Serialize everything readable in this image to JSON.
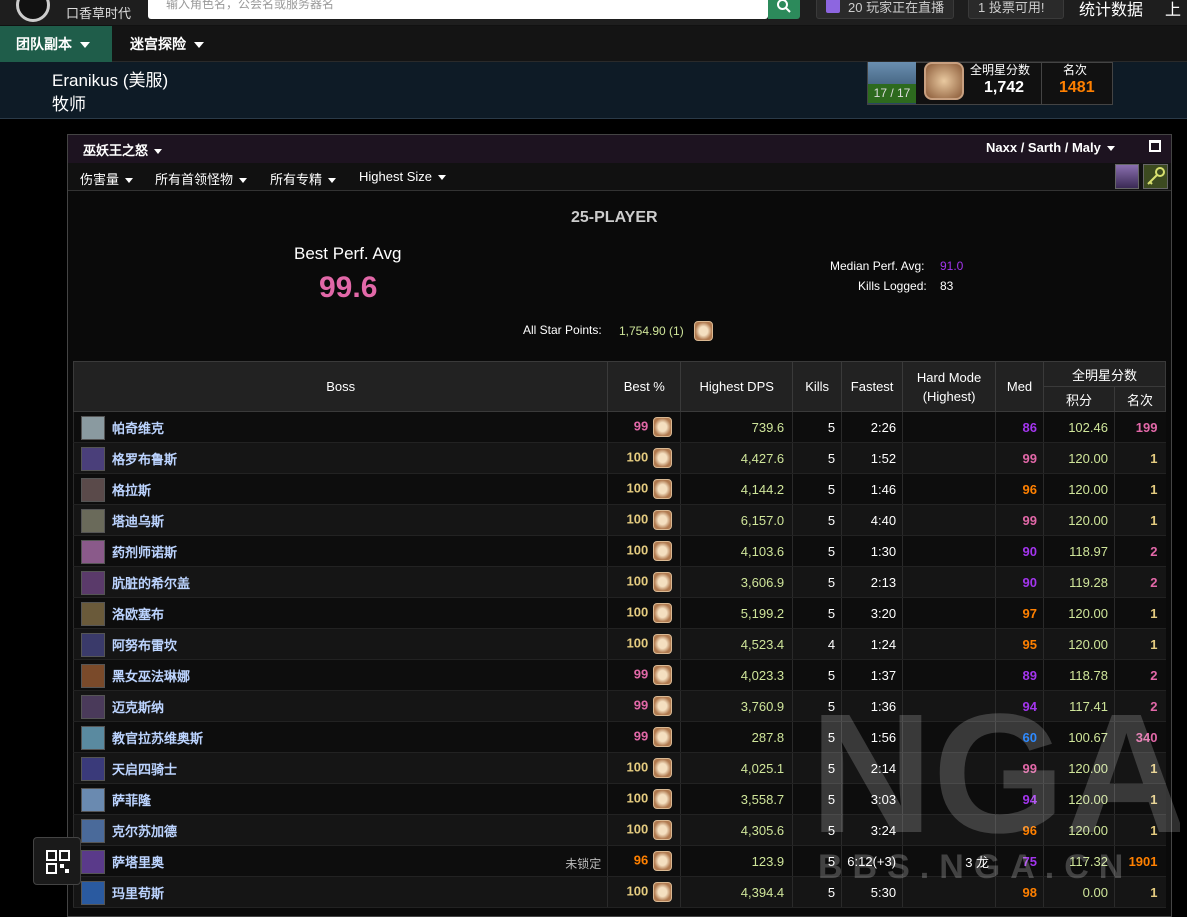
{
  "topbar": {
    "logo_text": "口香草时代",
    "search_placeholder": "输入角色名，公会名或服务器名",
    "live_text": "20 玩家正在直播",
    "vote_text": "1 投票可用!",
    "stats_link": "统计数据",
    "prev_link": "上一"
  },
  "nav": {
    "items": [
      {
        "label": "团队副本"
      },
      {
        "label": "迷宫探险"
      }
    ]
  },
  "character": {
    "name": "Eranikus (美服)",
    "class": "牧师",
    "achievement_progress": "17 / 17",
    "allstar_label": "全明星分数",
    "allstar_score": "1,742",
    "rank_label": "名次",
    "rank_value": "1481"
  },
  "zone": {
    "title": "巫妖王之怒",
    "right_label": "Naxx / Sarth / Maly"
  },
  "filters": [
    "伤害量",
    "所有首领怪物",
    "所有专精",
    "Highest Size"
  ],
  "summary": {
    "title": "25-PLAYER",
    "best_perf_label": "Best Perf. Avg",
    "best_perf_value": "99.6",
    "median_label": "Median Perf. Avg:",
    "median_value": "91.0",
    "kills_label": "Kills Logged:",
    "kills_value": "83",
    "allstar_label": "All Star Points:",
    "allstar_value": "1,754.90 (1)"
  },
  "table": {
    "headers": {
      "boss": "Boss",
      "best": "Best %",
      "dps": "Highest DPS",
      "kills": "Kills",
      "fastest": "Fastest",
      "hardmode": "Hard Mode",
      "hardmode_sub": "(Highest)",
      "med": "Med",
      "allstar": "全明星分数",
      "points": "积分",
      "rank": "名次"
    },
    "rows": [
      {
        "boss": "帕奇维克",
        "best": "99",
        "best_color": "#e268a8",
        "dps": "739.6",
        "kills": "5",
        "fastest": "2:26",
        "hardmode": "",
        "med": "86",
        "med_color": "#a335ee",
        "points": "102.46",
        "rank": "199",
        "rank_color": "#e268a8",
        "icon_color": "#8a9aa0",
        "note": ""
      },
      {
        "boss": "格罗布鲁斯",
        "best": "100",
        "best_color": "#e5cc80",
        "dps": "4,427.6",
        "kills": "5",
        "fastest": "1:52",
        "hardmode": "",
        "med": "99",
        "med_color": "#e268a8",
        "points": "120.00",
        "rank": "1",
        "rank_color": "#e5cc80",
        "icon_color": "#4a3f7a",
        "note": ""
      },
      {
        "boss": "格拉斯",
        "best": "100",
        "best_color": "#e5cc80",
        "dps": "4,144.2",
        "kills": "5",
        "fastest": "1:46",
        "hardmode": "",
        "med": "96",
        "med_color": "#ff8000",
        "points": "120.00",
        "rank": "1",
        "rank_color": "#e5cc80",
        "icon_color": "#5a4a4a",
        "note": ""
      },
      {
        "boss": "塔迪乌斯",
        "best": "100",
        "best_color": "#e5cc80",
        "dps": "6,157.0",
        "kills": "5",
        "fastest": "4:40",
        "hardmode": "",
        "med": "99",
        "med_color": "#e268a8",
        "points": "120.00",
        "rank": "1",
        "rank_color": "#e5cc80",
        "icon_color": "#6a6a5a",
        "note": ""
      },
      {
        "boss": "药剂师诺斯",
        "best": "100",
        "best_color": "#e5cc80",
        "dps": "4,103.6",
        "kills": "5",
        "fastest": "1:30",
        "hardmode": "",
        "med": "90",
        "med_color": "#a335ee",
        "points": "118.97",
        "rank": "2",
        "rank_color": "#e268a8",
        "icon_color": "#8a5a8a",
        "note": ""
      },
      {
        "boss": "肮脏的希尔盖",
        "best": "100",
        "best_color": "#e5cc80",
        "dps": "3,606.9",
        "kills": "5",
        "fastest": "2:13",
        "hardmode": "",
        "med": "90",
        "med_color": "#a335ee",
        "points": "119.28",
        "rank": "2",
        "rank_color": "#e268a8",
        "icon_color": "#5a3a6a",
        "note": ""
      },
      {
        "boss": "洛欧塞布",
        "best": "100",
        "best_color": "#e5cc80",
        "dps": "5,199.2",
        "kills": "5",
        "fastest": "3:20",
        "hardmode": "",
        "med": "97",
        "med_color": "#ff8000",
        "points": "120.00",
        "rank": "1",
        "rank_color": "#e5cc80",
        "icon_color": "#6a5a3a",
        "note": ""
      },
      {
        "boss": "阿努布雷坎",
        "best": "100",
        "best_color": "#e5cc80",
        "dps": "4,523.4",
        "kills": "4",
        "fastest": "1:24",
        "hardmode": "",
        "med": "95",
        "med_color": "#ff8000",
        "points": "120.00",
        "rank": "1",
        "rank_color": "#e5cc80",
        "icon_color": "#3a3a6a",
        "note": ""
      },
      {
        "boss": "黑女巫法琳娜",
        "best": "99",
        "best_color": "#e268a8",
        "dps": "4,023.3",
        "kills": "5",
        "fastest": "1:37",
        "hardmode": "",
        "med": "89",
        "med_color": "#a335ee",
        "points": "118.78",
        "rank": "2",
        "rank_color": "#e268a8",
        "icon_color": "#7a4a2a",
        "note": ""
      },
      {
        "boss": "迈克斯纳",
        "best": "99",
        "best_color": "#e268a8",
        "dps": "3,760.9",
        "kills": "5",
        "fastest": "1:36",
        "hardmode": "",
        "med": "94",
        "med_color": "#a335ee",
        "points": "117.41",
        "rank": "2",
        "rank_color": "#e268a8",
        "icon_color": "#4a3a5a",
        "note": ""
      },
      {
        "boss": "教官拉苏维奥斯",
        "best": "99",
        "best_color": "#e268a8",
        "dps": "287.8",
        "kills": "5",
        "fastest": "1:56",
        "hardmode": "",
        "med": "60",
        "med_color": "#0070ff",
        "points": "100.67",
        "rank": "340",
        "rank_color": "#e268a8",
        "icon_color": "#5a8aa0",
        "note": ""
      },
      {
        "boss": "天启四骑士",
        "best": "100",
        "best_color": "#e5cc80",
        "dps": "4,025.1",
        "kills": "5",
        "fastest": "2:14",
        "hardmode": "",
        "med": "99",
        "med_color": "#e268a8",
        "points": "120.00",
        "rank": "1",
        "rank_color": "#e5cc80",
        "icon_color": "#3a3a7a",
        "note": ""
      },
      {
        "boss": "萨菲隆",
        "best": "100",
        "best_color": "#e5cc80",
        "dps": "3,558.7",
        "kills": "5",
        "fastest": "3:03",
        "hardmode": "",
        "med": "94",
        "med_color": "#a335ee",
        "points": "120.00",
        "rank": "1",
        "rank_color": "#e5cc80",
        "icon_color": "#6a8ab0",
        "note": ""
      },
      {
        "boss": "克尔苏加德",
        "best": "100",
        "best_color": "#e5cc80",
        "dps": "4,305.6",
        "kills": "5",
        "fastest": "3:24",
        "hardmode": "",
        "med": "96",
        "med_color": "#ff8000",
        "points": "120.00",
        "rank": "1",
        "rank_color": "#e5cc80",
        "icon_color": "#4a6a9a",
        "note": ""
      },
      {
        "boss": "萨塔里奥",
        "best": "96",
        "best_color": "#ff8000",
        "dps": "123.9",
        "kills": "5",
        "fastest": "6:12(+3)",
        "hardmode": "3 龙",
        "med": "75",
        "med_color": "#a335ee",
        "points": "117.32",
        "rank": "1901",
        "rank_color": "#ff8000",
        "icon_color": "#5a3a8a",
        "note": "未锁定"
      },
      {
        "boss": "玛里苟斯",
        "best": "100",
        "best_color": "#e5cc80",
        "dps": "4,394.4",
        "kills": "5",
        "fastest": "5:30",
        "hardmode": "",
        "med": "98",
        "med_color": "#ff8000",
        "points": "0.00",
        "rank": "1",
        "rank_color": "#e5cc80",
        "icon_color": "#2a5aa0",
        "note": ""
      }
    ]
  },
  "watermark": "BBS.NGA.CN"
}
